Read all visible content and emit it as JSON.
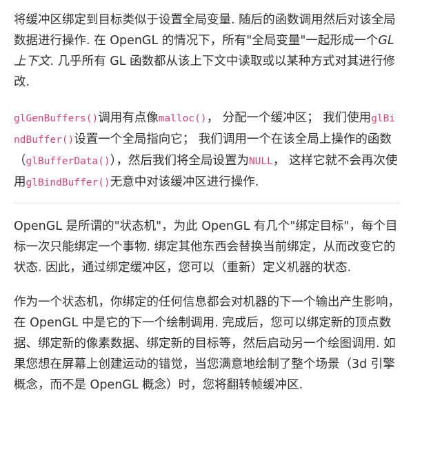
{
  "article": {
    "paragraph1": {
      "part1": "将缓冲区绑定到目标类似于设置全局变量. 随后的函数调用然后对该全局数据进行操作. 在 OpenGL 的情况下，所有\"全局变量\"一起形成一个",
      "emphasis": "GL 上下文",
      "part2": ". 几乎所有 GL 函数都从该上下文中读取或以某种方式对其进行修改."
    },
    "paragraph2": {
      "code1": "glGenBuffers()",
      "text1": "调用有点像",
      "code2": "malloc()",
      "text2": "， 分配一个缓冲区；  我们使用",
      "code3": "glBindBuffer()",
      "text3": "设置一个全局指向它；  我们调用一个在该全局上操作的函数  （",
      "code4": "glBufferData()",
      "text4": "），然后我们将全局设置为",
      "code5": "NULL",
      "text5": "，  这样它就不会再次使用",
      "code6": "glBindBuffer()",
      "text6": "无意中对该缓冲区进行操作."
    },
    "paragraph3": "OpenGL 是所谓的\"状态机\"，为此 OpenGL 有几个\"绑定目标\"，每个目标一次只能绑定一个事物. 绑定其他东西会替换当前绑定，从而改变它的状态. 因此，通过绑定缓冲区，您可以（重新）定义机器的状态.",
    "paragraph4": "作为一个状态机，你绑定的任何信息都会对机器的下一个输出产生影响，在 OpenGL 中是它的下一个绘制调用. 完成后，您可以绑定新的顶点数据、绑定新的像素数据、绑定新的目标等，然后启动另一个绘图调用. 如果您想在屏幕上创建运动的错觉，当您满意地绘制了整个场景（3d 引擎概念，而不是 OpenGL 概念）时，您将翻转帧缓冲区."
  },
  "colors": {
    "text": "#303030",
    "code": "#e0407a",
    "divider": "#e4e4e4"
  }
}
